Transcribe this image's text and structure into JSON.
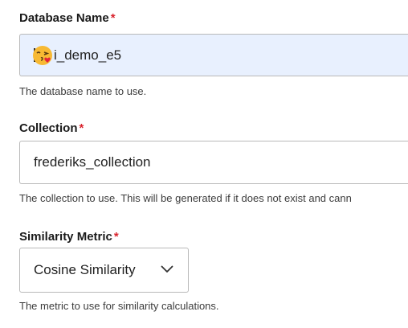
{
  "fields": {
    "database_name": {
      "label": "Database Name",
      "required_marker": "*",
      "value": "i_demo_e5",
      "leading_icon": "kissing-face-emoji",
      "help": "The database name to use."
    },
    "collection": {
      "label": "Collection",
      "required_marker": "*",
      "value": "frederiks_collection",
      "help": "The collection to use. This will be generated if it does not exist and cann"
    },
    "similarity_metric": {
      "label": "Similarity Metric",
      "required_marker": "*",
      "selected": "Cosine Similarity",
      "help": "The metric to use for similarity calculations."
    }
  },
  "colors": {
    "required": "#d9232d",
    "focused_input_bg": "#e8f0fe",
    "border": "#b9b9b9"
  }
}
